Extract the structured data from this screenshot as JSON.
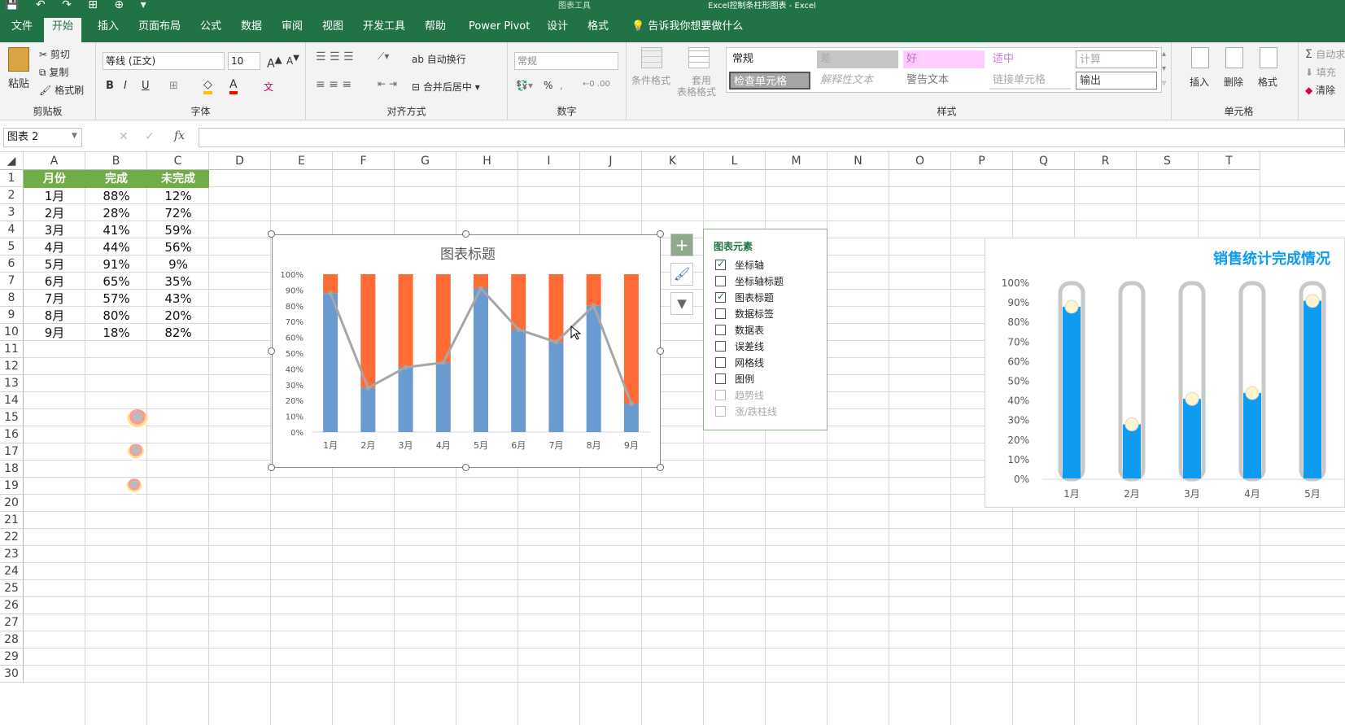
{
  "title_bar": {
    "quick_access": "💾 ↶ ↷ ⊞ ⊕ ▾",
    "context_tools": "图表工具",
    "title": "Excel控制条柱形图表  -  Excel"
  },
  "tabs": [
    "文件",
    "开始",
    "插入",
    "页面布局",
    "公式",
    "数据",
    "审阅",
    "视图",
    "开发工具",
    "帮助",
    "Power Pivot",
    "设计",
    "格式"
  ],
  "active_tab": "开始",
  "tell_me": "告诉我你想要做什么",
  "ribbon": {
    "clipboard": {
      "label": "剪贴板",
      "paste": "粘贴",
      "cut": "剪切",
      "copy": "复制",
      "format_painter": "格式刷"
    },
    "font": {
      "label": "字体",
      "font_name": "等线 (正文)",
      "font_size": "10"
    },
    "alignment": {
      "label": "对齐方式",
      "wrap": "自动换行",
      "merge": "合并后居中"
    },
    "number": {
      "label": "数字",
      "format": "常规"
    },
    "conditional": {
      "label": "条件格式",
      "table": "套用",
      "table2": "表格格式"
    },
    "styles": {
      "label": "样式",
      "cells": [
        "常规",
        "差",
        "好",
        "适中",
        "计算",
        "检查单元格",
        "解释性文本",
        "警告文本",
        "链接单元格",
        "输出"
      ]
    },
    "cells": {
      "label": "单元格",
      "insert": "插入",
      "delete": "删除",
      "format": "格式"
    },
    "editing": {
      "autosum": "自动求和",
      "fill": "填充",
      "clear": "清除"
    }
  },
  "name_box": "图表 2",
  "columns": [
    "A",
    "B",
    "C",
    "D",
    "E",
    "F",
    "G",
    "H",
    "I",
    "J",
    "K",
    "L",
    "M",
    "N",
    "O",
    "P",
    "Q",
    "R",
    "S",
    "T"
  ],
  "rows": [
    "1",
    "2",
    "3",
    "4",
    "5",
    "6",
    "7",
    "8",
    "9",
    "10",
    "11",
    "12",
    "13",
    "14",
    "15",
    "16",
    "17",
    "18",
    "19",
    "20",
    "21",
    "22",
    "23",
    "24",
    "25",
    "26",
    "27",
    "28",
    "29",
    "30"
  ],
  "table": {
    "headers": [
      "月份",
      "完成",
      "未完成"
    ],
    "rows": [
      [
        "1月",
        "88%",
        "12%"
      ],
      [
        "2月",
        "28%",
        "72%"
      ],
      [
        "3月",
        "41%",
        "59%"
      ],
      [
        "4月",
        "44%",
        "56%"
      ],
      [
        "5月",
        "91%",
        "9%"
      ],
      [
        "6月",
        "65%",
        "35%"
      ],
      [
        "7月",
        "57%",
        "43%"
      ],
      [
        "8月",
        "80%",
        "20%"
      ],
      [
        "9月",
        "18%",
        "82%"
      ]
    ]
  },
  "colors": {
    "excel_green": "#217346",
    "header_green": "#70ad47",
    "done_blue": "#6a9bd0",
    "undone_orange": "#ff6b35",
    "line_gray": "#a6a6a6",
    "chart2_blue": "#0f9bf0"
  },
  "chart_data": [
    {
      "type": "bar",
      "title": "图表标题",
      "categories": [
        "1月",
        "2月",
        "3月",
        "4月",
        "5月",
        "6月",
        "7月",
        "8月",
        "9月"
      ],
      "series": [
        {
          "name": "完成",
          "values": [
            0.88,
            0.28,
            0.41,
            0.44,
            0.91,
            0.65,
            0.57,
            0.8,
            0.18
          ]
        },
        {
          "name": "未完成",
          "values": [
            0.12,
            0.72,
            0.59,
            0.56,
            0.09,
            0.35,
            0.43,
            0.2,
            0.82
          ]
        }
      ],
      "line": [
        0.88,
        0.28,
        0.41,
        0.44,
        0.91,
        0.65,
        0.57,
        0.8,
        0.18
      ],
      "yticks": [
        "0%",
        "10%",
        "20%",
        "30%",
        "40%",
        "50%",
        "60%",
        "70%",
        "80%",
        "90%",
        "100%"
      ],
      "ylim": [
        0,
        1
      ],
      "stacked": true
    },
    {
      "type": "bar",
      "title": "销售统计完成情况",
      "categories": [
        "1月",
        "2月",
        "3月",
        "4月",
        "5月"
      ],
      "values": [
        0.88,
        0.28,
        0.41,
        0.44,
        0.91
      ],
      "yticks": [
        "0%",
        "10%",
        "20%",
        "30%",
        "40%",
        "50%",
        "60%",
        "70%",
        "80%",
        "90%",
        "100%"
      ],
      "ylim": [
        0,
        1
      ]
    }
  ],
  "chart_elements": {
    "title": "图表元素",
    "items": [
      {
        "label": "坐标轴",
        "checked": true,
        "enabled": true
      },
      {
        "label": "坐标轴标题",
        "checked": false,
        "enabled": true
      },
      {
        "label": "图表标题",
        "checked": true,
        "enabled": true
      },
      {
        "label": "数据标签",
        "checked": false,
        "enabled": true
      },
      {
        "label": "数据表",
        "checked": false,
        "enabled": true
      },
      {
        "label": "误差线",
        "checked": false,
        "enabled": true
      },
      {
        "label": "网格线",
        "checked": false,
        "enabled": true
      },
      {
        "label": "图例",
        "checked": false,
        "enabled": true
      },
      {
        "label": "趋势线",
        "checked": false,
        "enabled": false
      },
      {
        "label": "涨/跌柱线",
        "checked": false,
        "enabled": false
      }
    ]
  }
}
